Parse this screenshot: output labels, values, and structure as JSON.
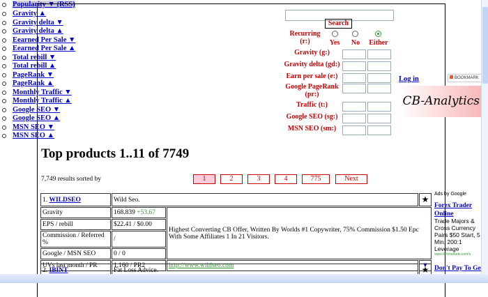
{
  "sort_header": {
    "overlap_a": "Popularity ▼",
    "overlap_b": "(RSS)"
  },
  "sort_options": [
    "Gravity ▲",
    "Gravity delta ▼",
    "Gravity delta ▲",
    "Eearned Per Sale ▼",
    "Eearned Per Sale ▲",
    "Total rebill ▼",
    "Total rebill ▲",
    "PageRank ▼",
    "PageRank ▲",
    "Monthly Traffic ▼",
    "Monthly Traffic ▲",
    "Google SEO ▼",
    "Google SEO ▲",
    "MSN SEO ▼",
    "MSN SEO ▲"
  ],
  "search": {
    "value": "",
    "button": "Search"
  },
  "filters": {
    "recurring_label": "Recurring",
    "recurring_code": "(r:)",
    "options": [
      "Yes",
      "No",
      "Either"
    ],
    "selected": "Either",
    "fields": [
      "Gravity (g:)",
      "Gravity delta (gd:)",
      "Earn per sale (e:)",
      "Google PageRank",
      "Traffic (t:)",
      "Google SEO (sg:)",
      "MSN SEO (sm:)"
    ],
    "pagerank_code": "(pr:)"
  },
  "login": "Log in",
  "bookmark": "BOOKMARK",
  "logo": "CB-Analytics",
  "heading": "Top products 1..11 of 7749",
  "results_text": "7,749 results sorted by",
  "pagination": [
    "1",
    "2",
    "3",
    "4",
    "775",
    "Next"
  ],
  "current_page": "1",
  "products": [
    {
      "rank": "1.",
      "name": "WILDSEO",
      "title": "Wild Seo.",
      "gravity": "168.839",
      "gravity_delta": "+53.67",
      "eps": "$22.41 / $0.00",
      "commission": "/",
      "seo": "0 / 0",
      "uvs": "1,160 / PR2",
      "url": "http://www.wildseo.com",
      "description": "Highest Converting CB Offer, Written By Worlds #1 Copywriter, 75% Commission $1.50 Epc With Some Affiliates 1 In 21 Visitors."
    },
    {
      "rank": "2.",
      "name": "IBINT",
      "title": "Fat Loss Advice."
    }
  ],
  "row_labels": [
    "Gravity",
    "EPS / rebill",
    "Commission / Referred %",
    "Google / MSN SEO",
    "UVs last month / PR"
  ],
  "ads": {
    "label": "Ads by Google",
    "items": [
      {
        "title": "Forex Trader Online",
        "text": "Trade Majors & Cross Currency Pairs $50 Start, 5 Min, 200:1 Leverage",
        "url": "www.IFXmarkets.com/s"
      },
      {
        "title": "Don't Pay To Get"
      }
    ]
  },
  "colors": {
    "link": "#0000cc",
    "form_label": "#cc0000",
    "delta": "#339933"
  }
}
